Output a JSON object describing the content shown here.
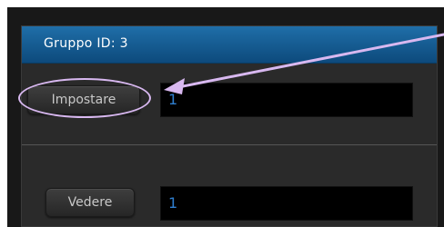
{
  "dialog": {
    "title": "Gruppo ID: 3"
  },
  "set_row": {
    "button_label": "Impostare",
    "value": "1"
  },
  "view_row": {
    "button_label": "Vedere",
    "value": "1"
  },
  "colors": {
    "titlebar": "#1565a0",
    "field_text": "#2f7fd0",
    "annotation": "#d8b8f0"
  },
  "annotation": {
    "arrow_icon": "arrow-pointing-left-icon",
    "highlight_shape": "ellipse"
  }
}
